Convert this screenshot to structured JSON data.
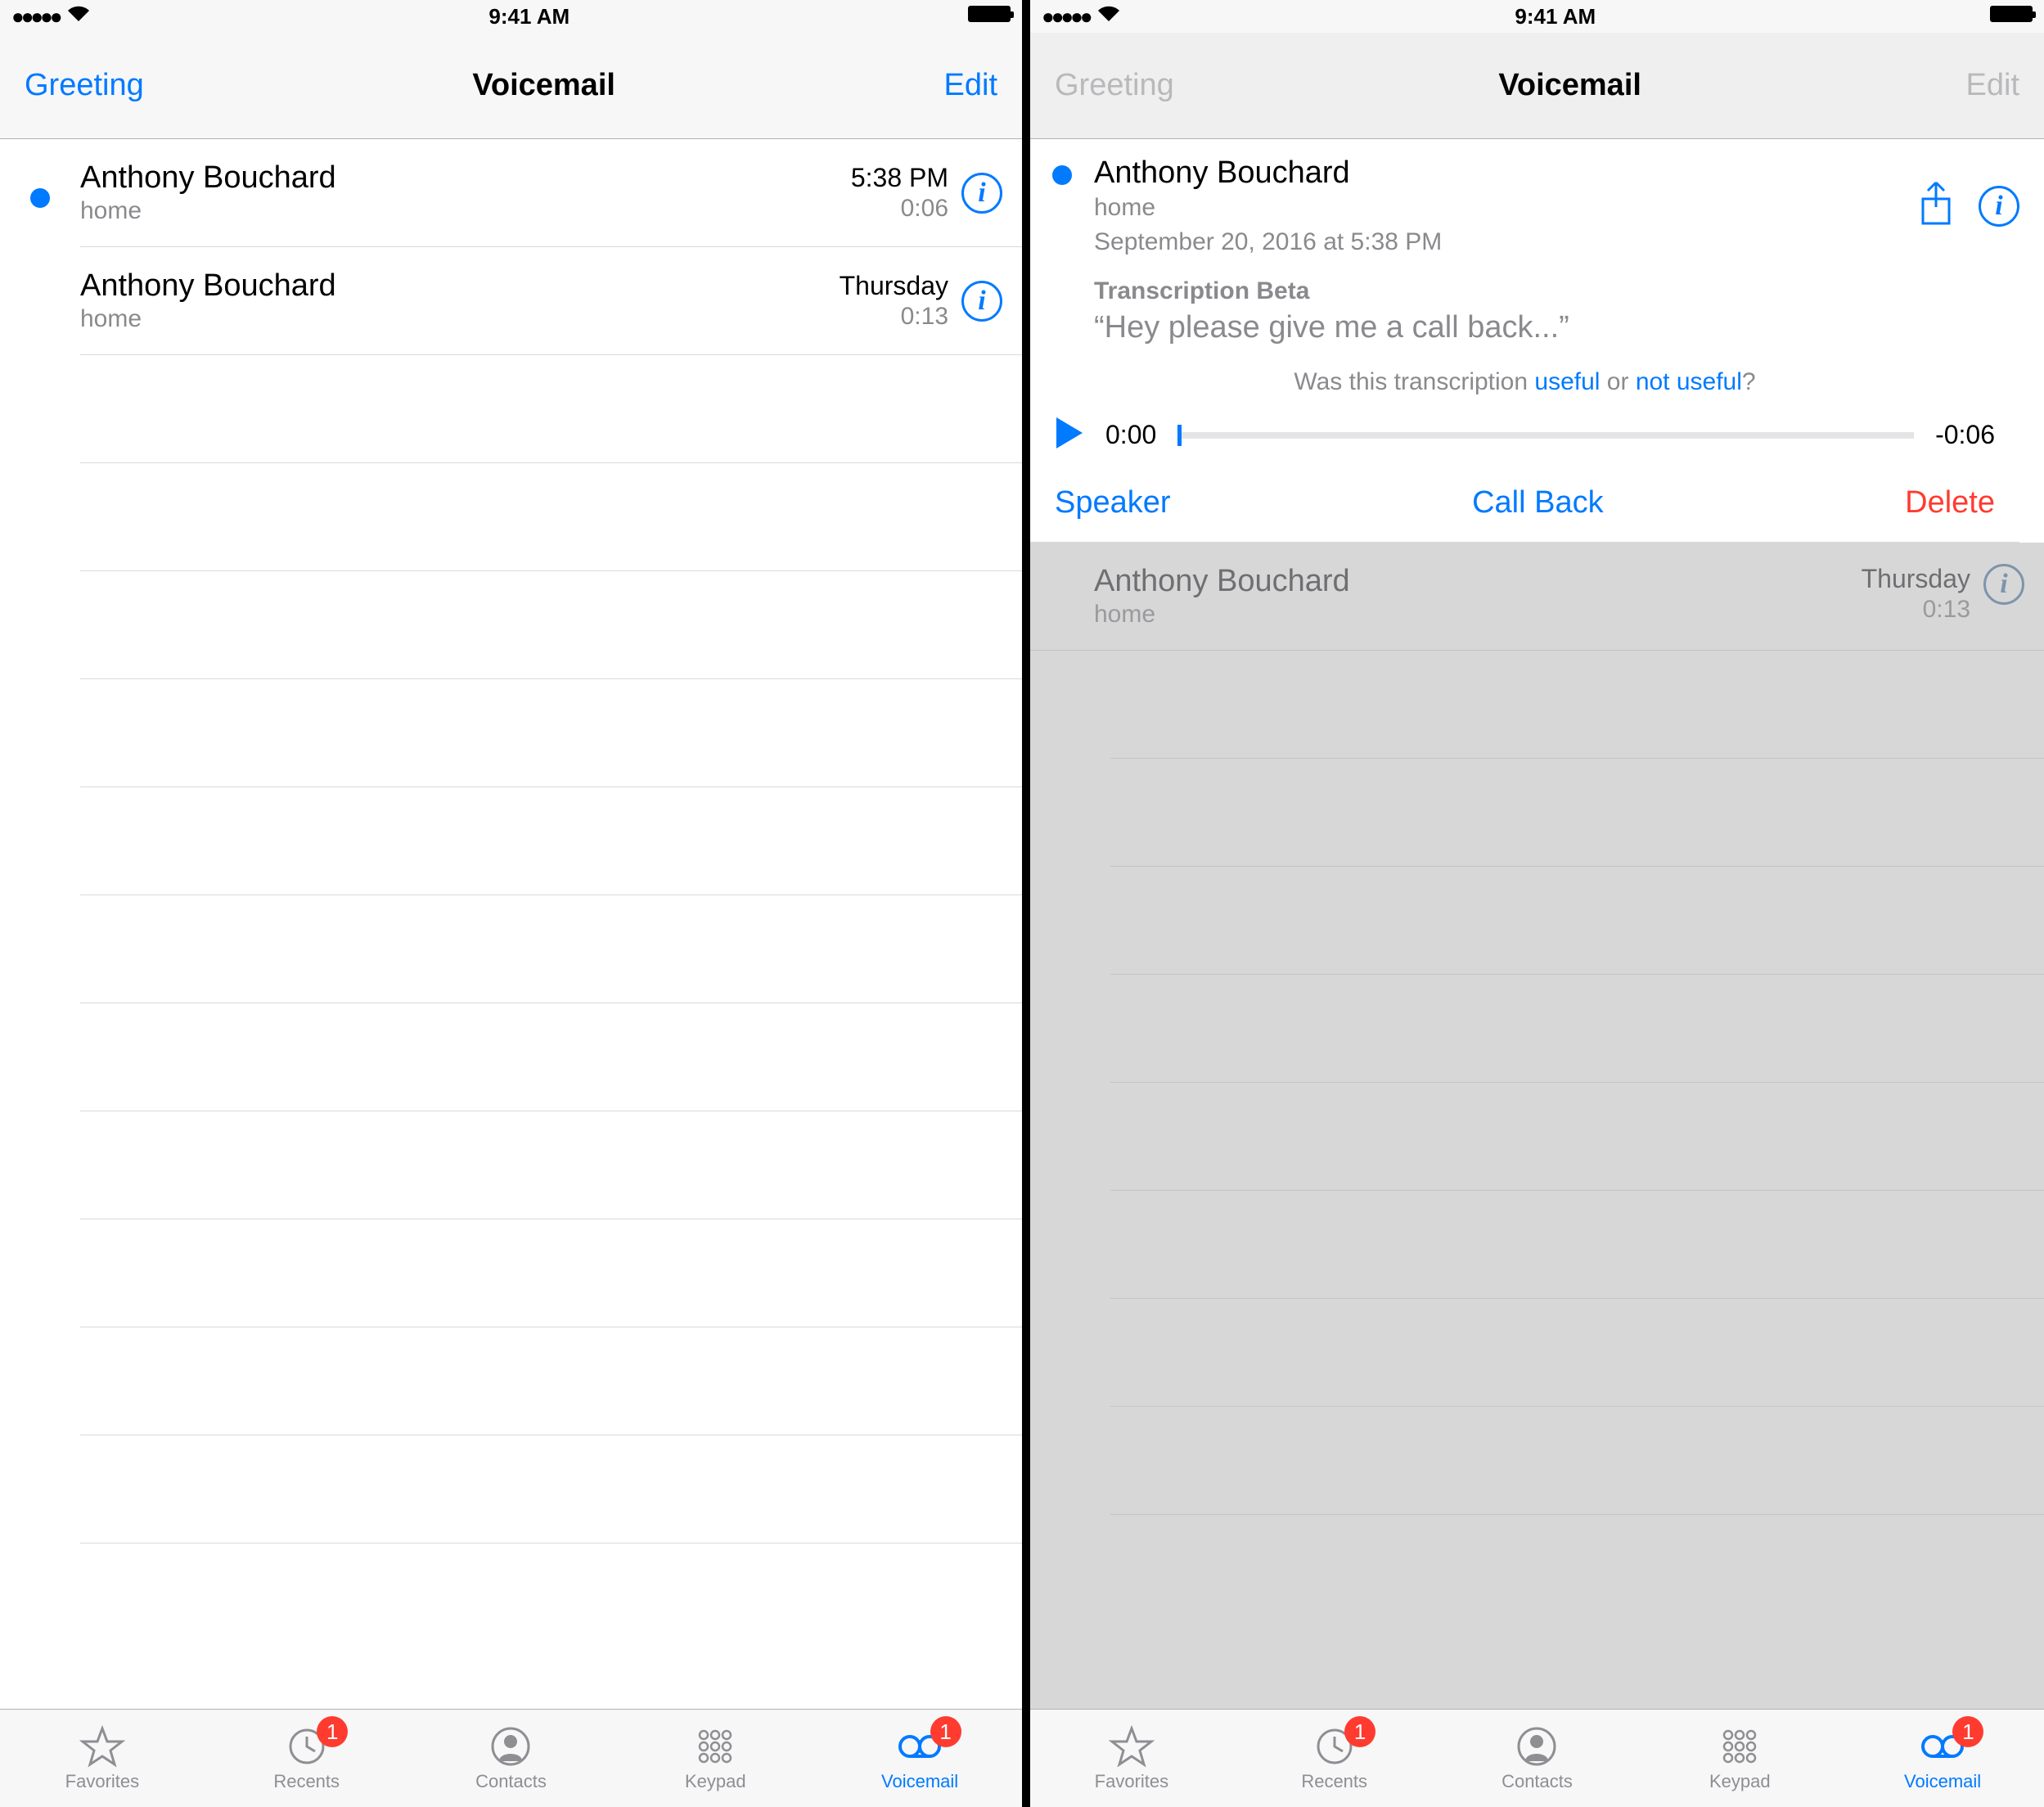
{
  "status": {
    "time": "9:41 AM"
  },
  "nav": {
    "greeting": "Greeting",
    "title": "Voicemail",
    "edit": "Edit"
  },
  "left": {
    "rows": [
      {
        "name": "Anthony Bouchard",
        "sub": "home",
        "time": "5:38 PM",
        "dur": "0:06",
        "unread": true
      },
      {
        "name": "Anthony Bouchard",
        "sub": "home",
        "time": "Thursday",
        "dur": "0:13",
        "unread": false
      }
    ]
  },
  "right": {
    "detail": {
      "name": "Anthony Bouchard",
      "sub": "home",
      "date": "September 20, 2016 at 5:38 PM",
      "trans_label": "Transcription Beta",
      "trans_text": "“Hey please give me a call back...”",
      "feedback_prefix": "Was this transcription ",
      "feedback_useful": "useful",
      "feedback_or": " or ",
      "feedback_notuseful": "not useful",
      "feedback_q": "?",
      "elapsed": "0:00",
      "remaining": "-0:06",
      "speaker": "Speaker",
      "callback": "Call Back",
      "delete": "Delete"
    },
    "row2": {
      "name": "Anthony Bouchard",
      "sub": "home",
      "time": "Thursday",
      "dur": "0:13"
    }
  },
  "tabs": {
    "favorites": "Favorites",
    "recents": "Recents",
    "contacts": "Contacts",
    "keypad": "Keypad",
    "voicemail": "Voicemail",
    "recents_badge": "1",
    "voicemail_badge": "1"
  }
}
